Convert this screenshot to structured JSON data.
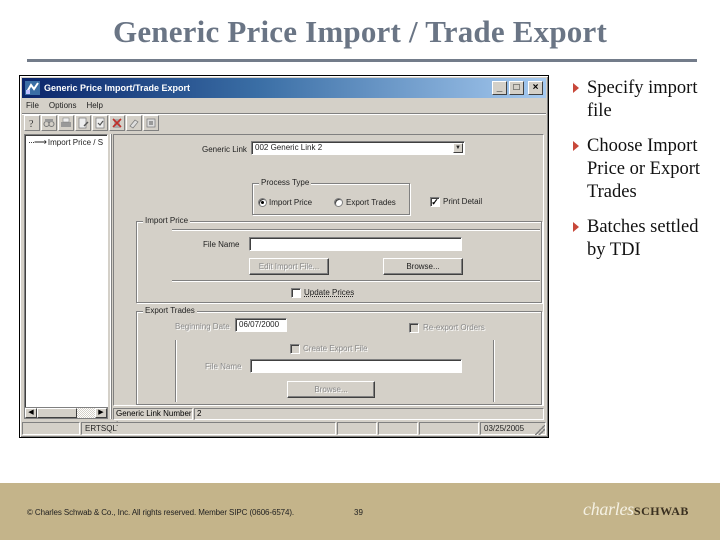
{
  "slide": {
    "title": "Generic Price Import / Trade Export",
    "bullets": [
      "Specify import file",
      "Choose Import Price or Export Trades",
      "Batches settled by TDI"
    ],
    "footer": {
      "copyright": "© Charles Schwab & Co., Inc.  All rights reserved.  Member SIPC  (0606-6574).",
      "page_number": "39",
      "logo_script": "charles",
      "logo_caps": "SCHWAB"
    },
    "colors": {
      "title": "#6a7585",
      "bullet_marker": "#c8483a",
      "footer_bg": "#c4b48a"
    }
  },
  "window": {
    "title": "Generic Price Import/Trade Export",
    "controls": {
      "minimize": "_",
      "maximize": "□",
      "close": "×"
    },
    "menu": [
      "File",
      "Options",
      "Help"
    ],
    "toolbar_icons": [
      "help-icon",
      "binoculars-icon",
      "print-icon",
      "edit-document-icon",
      "checklist-icon",
      "delete-icon",
      "eraser-icon",
      "export-icon"
    ],
    "tree": {
      "item": "Import Price / S"
    },
    "form": {
      "generic_link_label": "Generic Link",
      "generic_link_value": "002      Generic Link 2",
      "process_type": {
        "label": "Process Type",
        "options": [
          "Import Price",
          "Export Trades"
        ],
        "selected": "Import Price"
      },
      "print_detail_label": "Print Detail",
      "print_detail_checked": true,
      "import_price": {
        "group_label": "Import Price",
        "file_name_label": "File Name",
        "file_name_value": "",
        "edit_button": "Edit Import File...",
        "browse_button": "Browse...",
        "update_prices_label": "Update Prices",
        "update_prices_checked": false
      },
      "export_trades": {
        "group_label": "Export Trades",
        "beginning_date_label": "Beginning Date",
        "beginning_date_value": "06/07/2000",
        "reexport_label": "Re-export Orders",
        "create_export_label": "Create Export File",
        "file_name_label": "File Name",
        "file_name_value": "",
        "browse_button": "Browse..."
      }
    },
    "link_number_label": "Generic Link Number :",
    "link_number_value": "2",
    "status": {
      "db": "ERTSQL",
      "date": "03/25/2005"
    }
  }
}
